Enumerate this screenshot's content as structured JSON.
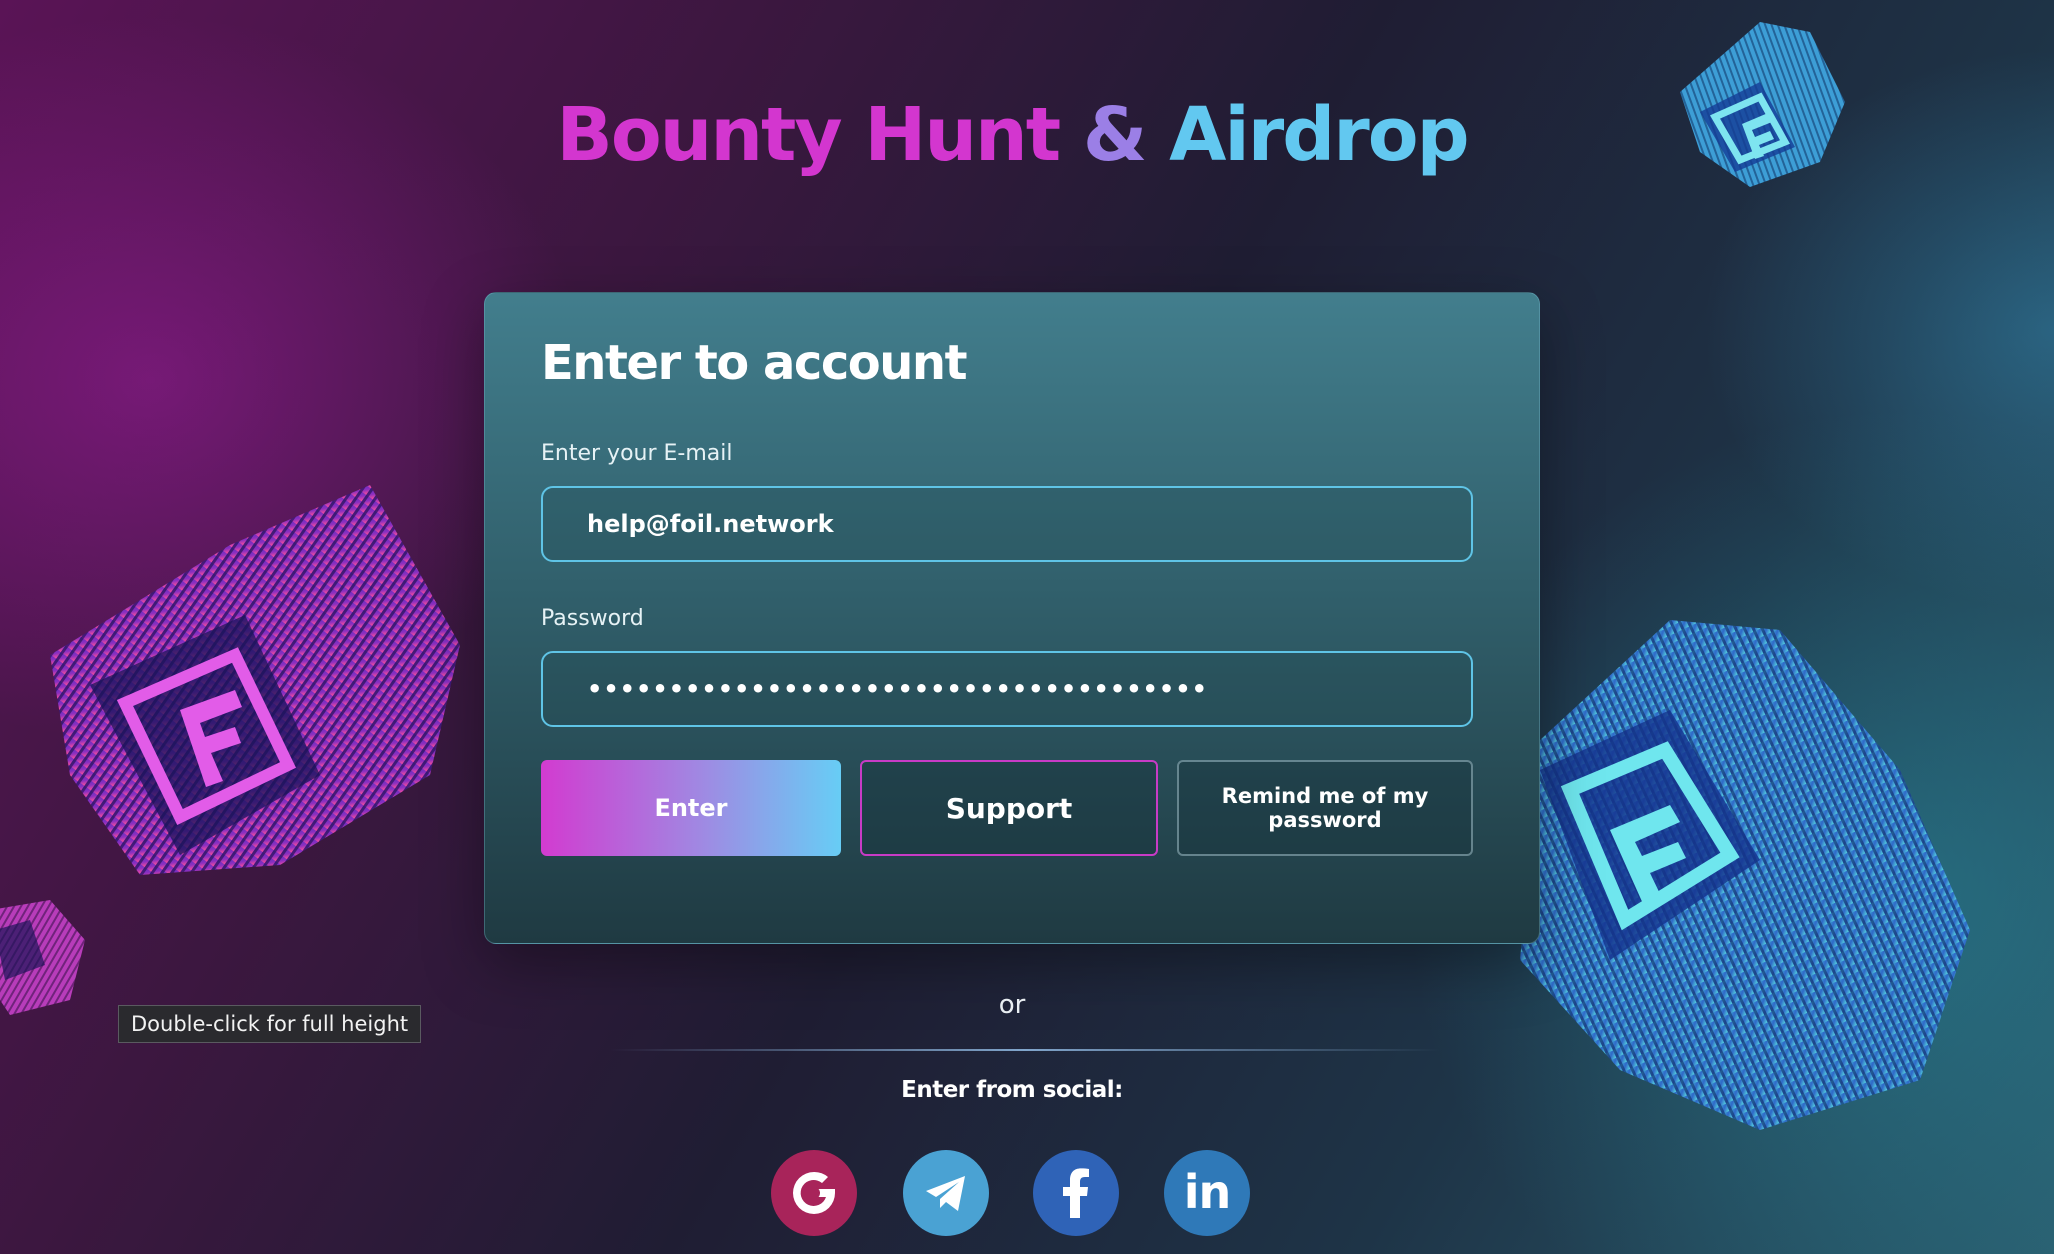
{
  "header": {
    "title_part1": "Bounty Hunt",
    "title_amp": "&",
    "title_part2": "Airdrop"
  },
  "login": {
    "heading": "Enter to account",
    "email_label": "Enter your E-mail",
    "email_value": "help@foil.network",
    "password_label": "Password",
    "password_value": "••••••••••••••••••••••••••••••••••••••",
    "enter_label": "Enter",
    "support_label": "Support",
    "remind_label": "Remind me of my password"
  },
  "social": {
    "or_text": "or",
    "title": "Enter from social:",
    "providers": [
      {
        "name": "google-icon",
        "color": "#a8245a"
      },
      {
        "name": "telegram-icon",
        "color": "#4aa2d3"
      },
      {
        "name": "facebook-icon",
        "color": "#2f63b7"
      },
      {
        "name": "linkedin-icon",
        "color": "#2f79b8",
        "glyph": "in"
      }
    ]
  },
  "tooltip": {
    "text": "Double-click for full height"
  },
  "colors": {
    "accent_pink": "#d336cf",
    "accent_purple": "#9b7fe6",
    "accent_cyan": "#62c8f0",
    "input_border": "#5fc4e6"
  }
}
